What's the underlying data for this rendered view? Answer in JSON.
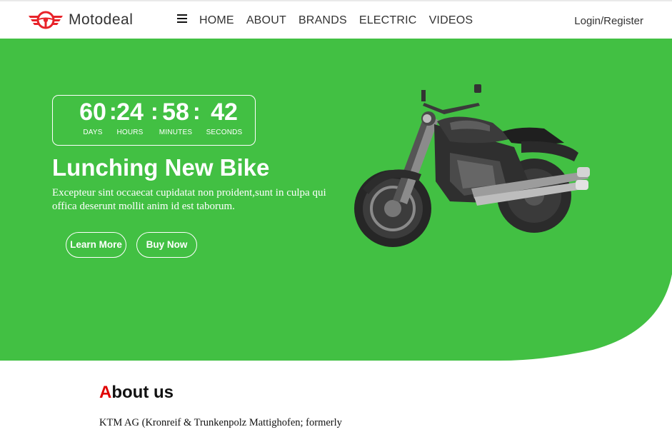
{
  "brand": {
    "name": "Motodeal",
    "accent_color": "#e8232a"
  },
  "nav": {
    "menu_icon": "hamburger-icon",
    "items": [
      "HOME",
      "ABOUT",
      "BRANDS",
      "ELECTRIC",
      "VIDEOS"
    ],
    "login": "Login/Register"
  },
  "hero": {
    "bg_color": "#42c043",
    "countdown": {
      "days": "60",
      "hours": "24",
      "minutes": "58",
      "seconds": "42",
      "days_label": "DAYS",
      "hours_label": "HOURS",
      "minutes_label": "MINUTES",
      "seconds_label": "SECONDS",
      "separator": ":"
    },
    "title": "Lunching New Bike",
    "description": "Excepteur sint occaecat cupidatat non proident,sunt in culpa qui offica deserunt mollit anim id est taborum.",
    "learn_more": "Learn More",
    "buy_now": "Buy Now",
    "image": "motorcycle-image"
  },
  "about": {
    "title_first": "A",
    "title_rest": "bout us",
    "text": "KTM AG (Kronreif & Trunkenpolz Mattighofen; formerly"
  }
}
